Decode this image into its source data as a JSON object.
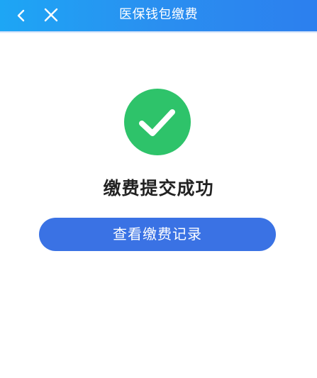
{
  "nav": {
    "title": "医保钱包缴费",
    "back_icon": "chevron-left-icon",
    "close_icon": "close-icon",
    "gradient_start": "#1da6f5",
    "gradient_end": "#2c7fee"
  },
  "result": {
    "icon": "check-circle-icon",
    "icon_color": "#2ec36a",
    "title": "缴费提交成功"
  },
  "actions": {
    "view_records_label": "查看缴费记录",
    "button_color": "#3a72e4"
  }
}
